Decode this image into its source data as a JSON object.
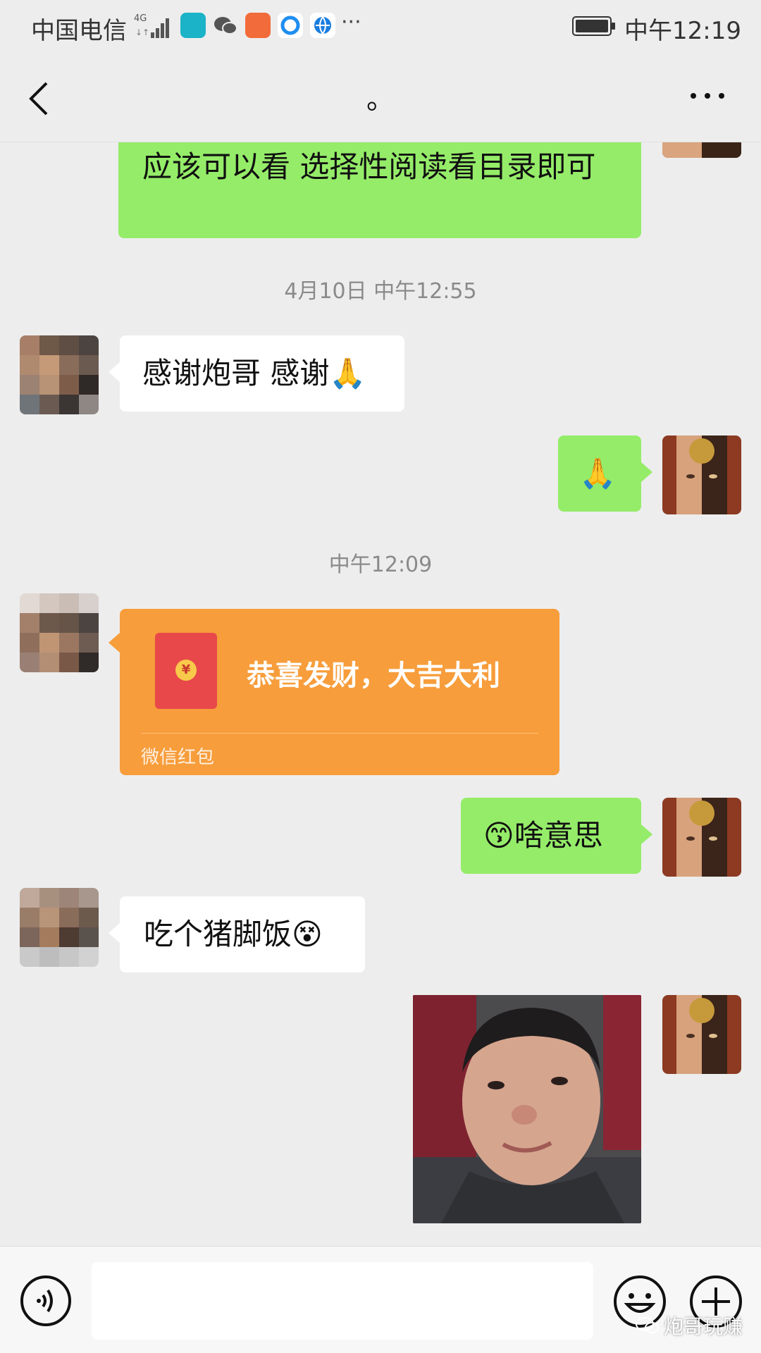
{
  "status_bar": {
    "carrier": "中国电信",
    "network": "4G",
    "more": "···",
    "time": "中午12:19"
  },
  "nav": {
    "title": "。"
  },
  "messages": [
    {
      "type": "text",
      "from": "me",
      "text": "应该可以看  选择性阅读看目录即可"
    },
    {
      "type": "timestamp",
      "text": "4月10日 中午12:55"
    },
    {
      "type": "text",
      "from": "other",
      "text": "感谢炮哥 感谢🙏"
    },
    {
      "type": "text",
      "from": "me",
      "text": "🙏"
    },
    {
      "type": "timestamp",
      "text": "中午12:09"
    },
    {
      "type": "red_packet",
      "from": "other",
      "title": "恭喜发财，大吉大利",
      "label": "微信红包",
      "coin": "¥"
    },
    {
      "type": "text",
      "from": "me",
      "text": "😙啥意思"
    },
    {
      "type": "text",
      "from": "other",
      "text": "吃个猪脚饭😵"
    },
    {
      "type": "sticker",
      "from": "me",
      "subject": "meme-photo"
    }
  ],
  "input": {
    "value": "",
    "placeholder": ""
  },
  "watermark": "炮哥玩赚",
  "colors": {
    "my_bubble": "#95ec69",
    "other_bubble": "#ffffff",
    "red_packet": "#f79d3b",
    "background": "#ededed"
  }
}
